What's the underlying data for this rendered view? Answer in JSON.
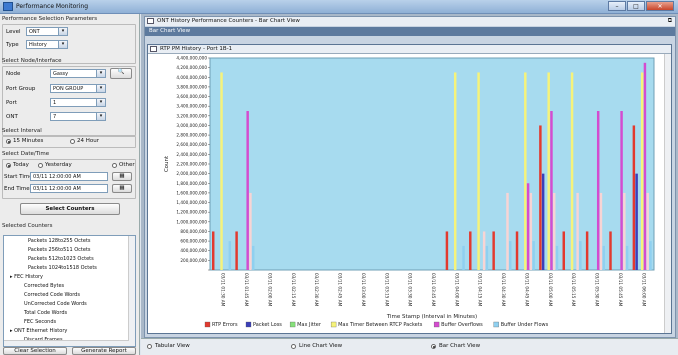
{
  "app": {
    "title": "Performance Monitoring"
  },
  "left": {
    "params_title": "Performance Selection Parameters",
    "level_label": "Level",
    "level_value": "ONT",
    "type_label": "Type",
    "type_value": "History",
    "node_iface_title": "Select Node/Interface",
    "node_label": "Node",
    "node_value": "Gassy",
    "portgroup_label": "Port Group",
    "portgroup_value": "PON GROUP",
    "port_label": "Port",
    "port_value": "1",
    "ont_label": "ONT",
    "ont_value": "7",
    "interval_title": "Select Interval",
    "interval_opt1": "15 Minutes",
    "interval_opt2": "24 Hour",
    "datetime_title": "Select Date/Time",
    "dt_today": "Today",
    "dt_yesterday": "Yesterday",
    "dt_other": "Other",
    "start_label": "Start Time",
    "start_value": "03/11 12:00:00 AM",
    "end_label": "End Time",
    "end_value": "03/11 12:00:00 AM",
    "select_counters_btn": "Select Counters",
    "selected_counters_title": "Selected Counters",
    "tree": [
      "Packets 128to255 Octets",
      "Packets 256to511 Octets",
      "Packets 512to1023 Octets",
      "Packets 1024to1518 Octets",
      "FEC History",
      "Corrected Bytes",
      "Corrected Code Words",
      "UnCorrected Code Words",
      "Total Code Words",
      "FEC Seconds",
      "ONT Ethernet History",
      "Discard Frames"
    ],
    "clear_btn": "Clear Selection",
    "generate_btn": "Generate Report"
  },
  "doc": {
    "title": "ONT History Performance Counters - Bar Chart View",
    "subheader": "Bar Chart View"
  },
  "chartwin": {
    "title": "RTP PM History - Port 1B-1"
  },
  "bottom": {
    "tabular": "Tabular View",
    "line": "Line Chart View",
    "bar": "Bar Chart View"
  },
  "chart_data": {
    "type": "bar",
    "title": "",
    "xlabel": "Time Stamp (Interval in Minutes)",
    "ylabel": "Count",
    "ylim": [
      0,
      4400000000
    ],
    "yticks": [
      "4,400,000,000",
      "4,200,000,000",
      "4,000,000,000",
      "3,800,000,000",
      "3,600,000,000",
      "3,400,000,000",
      "3,200,000,000",
      "3,000,000,000",
      "2,800,000,000",
      "2,600,000,000",
      "2,400,000,000",
      "2,200,000,000",
      "2,000,000,000",
      "1,800,000,000",
      "1,600,000,000",
      "1,400,000,000",
      "1,200,000,000",
      "1,000,000,000",
      "800,000,000",
      "600,000,000",
      "400,000,000",
      "200,000,000",
      ""
    ],
    "categories": [
      "03/11 01:30 AM",
      "03/11 01:45 AM",
      "03/11 02:00 AM",
      "03/11 02:15 AM",
      "03/11 02:30 AM",
      "03/11 02:45 AM",
      "03/11 03:00 AM",
      "03/11 03:15 AM",
      "03/11 03:30 AM",
      "03/11 03:45 AM",
      "03/11 04:00 AM",
      "03/11 04:15 AM",
      "03/11 04:30 AM",
      "03/11 04:45 AM",
      "03/11 05:00 AM",
      "03/11 05:15 AM",
      "03/11 05:30 AM",
      "03/11 05:45 AM",
      "03/11 06:00 AM"
    ],
    "series": [
      {
        "name": "RTP Errors",
        "color": "#e23a2f",
        "values": [
          800000000,
          800000000,
          0,
          0,
          0,
          0,
          0,
          0,
          0,
          0,
          800000000,
          800000000,
          800000000,
          800000000,
          3000000000,
          800000000,
          800000000,
          800000000,
          3000000000
        ]
      },
      {
        "name": "Packet Loss",
        "color": "#3b3fb8",
        "values": [
          0,
          0,
          0,
          0,
          0,
          0,
          0,
          0,
          0,
          0,
          0,
          0,
          0,
          0,
          2000000000,
          0,
          0,
          0,
          2000000000
        ]
      },
      {
        "name": "Max Jitter",
        "color": "#86e07a",
        "values": [
          0,
          0,
          0,
          0,
          0,
          0,
          0,
          0,
          0,
          0,
          0,
          0,
          0,
          0,
          0,
          0,
          0,
          0,
          0
        ]
      },
      {
        "name": "Max Time Between RTCP Packets",
        "color": "#f6f37a",
        "values": [
          4100000000,
          0,
          0,
          0,
          0,
          0,
          0,
          0,
          0,
          0,
          4100000000,
          4100000000,
          0,
          4100000000,
          4100000000,
          4100000000,
          0,
          0,
          4100000000
        ]
      },
      {
        "name": "Buffer Overflows",
        "color": "#d44ccf",
        "values": [
          0,
          3300000000,
          0,
          0,
          0,
          0,
          0,
          0,
          0,
          0,
          0,
          0,
          0,
          1800000000,
          3300000000,
          0,
          3300000000,
          3300000000,
          4300000000
        ]
      },
      {
        "name": "Buffer Under Flows",
        "color": "#f8d4d4",
        "values": [
          0,
          1600000000,
          0,
          0,
          0,
          0,
          0,
          0,
          0,
          0,
          0,
          800000000,
          1600000000,
          1600000000,
          1600000000,
          1600000000,
          1600000000,
          1600000000,
          1600000000
        ]
      },
      {
        "name": "Buffer Under Flows",
        "color": "#8fd0f0",
        "values": [
          600000000,
          500000000,
          0,
          0,
          0,
          0,
          0,
          0,
          0,
          0,
          500000000,
          500000000,
          600000000,
          600000000,
          500000000,
          600000000,
          500000000,
          500000000,
          600000000
        ]
      }
    ],
    "legend": [
      "RTP Errors",
      "Packet Loss",
      "Max Jitter",
      "Max Timer Between RTCP Packets",
      "Buffer Overflows",
      "Buffer Under Flows"
    ],
    "legend_colors": [
      "#e23a2f",
      "#3b3fb8",
      "#86e07a",
      "#f6f37a",
      "#d44ccf",
      "#8fd0f0"
    ]
  }
}
